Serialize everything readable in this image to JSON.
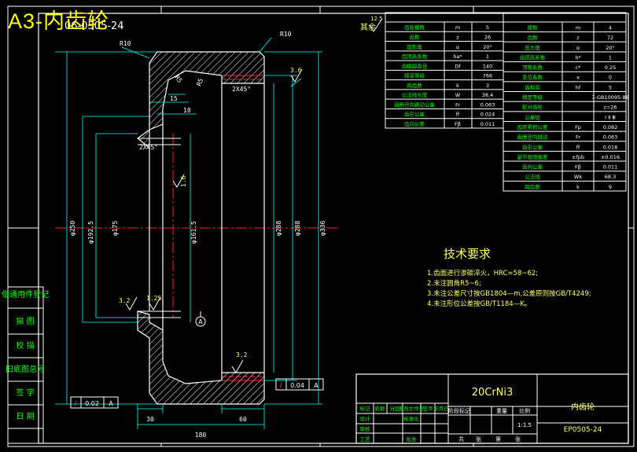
{
  "header": {
    "title": "A3-内齿轮",
    "underlay": "06-0505-24"
  },
  "drawing": {
    "material": "20CrNi3",
    "part_name": "内齿轮",
    "drawing_no": "EP0505-24",
    "scale": "1:1.5",
    "corner_note": "其余",
    "corner_roughness": "12.5"
  },
  "tech_requirements": {
    "title": "技术要求",
    "items": [
      "1.齿面进行渗碳淬火，HRC=58~62;",
      "2.未注圆角R5~6;",
      "3.未注公差尺寸按GB1804—m,公差原则按GB/T4249;",
      "4.未注形位公差按GB/T1184—K。"
    ]
  },
  "left_column": [
    "借通用件登记",
    "描 图",
    "校 描",
    "旧底图总号",
    "签 字",
    "日 期"
  ],
  "gear_table_left": [
    [
      "齿轮模数",
      "m",
      "5"
    ],
    [
      "齿数",
      "z",
      "26"
    ],
    [
      "齿形角",
      "α",
      "20°"
    ],
    [
      "齿顶高系数",
      "ha*",
      "1"
    ],
    [
      "齿根圆直径",
      "Df",
      "140"
    ],
    [
      "精度等级",
      "",
      "766"
    ],
    [
      "跨齿数",
      "k",
      "3"
    ],
    [
      "公法线长度",
      "W",
      "38.4"
    ],
    [
      "齿圈径向跳动公差",
      "Fr",
      "0.063"
    ],
    [
      "齿形公差",
      "ff",
      "0.024"
    ],
    [
      "齿向公差",
      "Fβ",
      "0.011"
    ]
  ],
  "gear_table_right": [
    [
      "模数",
      "m",
      "4"
    ],
    [
      "齿数",
      "z",
      "72"
    ],
    [
      "压力角",
      "α",
      "20°"
    ],
    [
      "齿顶高系数",
      "h*",
      "1"
    ],
    [
      "顶隙系数",
      "c*",
      "0.25"
    ],
    [
      "变位系数",
      "x",
      "0"
    ],
    [
      "齿根高",
      "hf",
      "5"
    ],
    [
      "精度等级",
      "",
      "7-GB10095-88"
    ],
    [
      "配对齿轮",
      "",
      "z=26"
    ],
    [
      "公差组",
      "",
      "Ⅰ Ⅱ Ⅲ"
    ],
    [
      "齿距累积公差",
      "Fp",
      "0.082"
    ],
    [
      "齿圈径向跳动",
      "Fr",
      "0.063"
    ],
    [
      "齿形公差",
      "ff",
      "0.018"
    ],
    [
      "基节极限偏差",
      "±fpb",
      "±0.016"
    ],
    [
      "齿向公差",
      "Fβ",
      "0.011"
    ],
    [
      "公法线",
      "Wk",
      "68.3"
    ],
    [
      "跨齿数",
      "k",
      "9"
    ]
  ],
  "title_block": {
    "rows": [
      [
        "标记",
        "处数",
        "分区",
        "更改文件号",
        "签字",
        "年月日"
      ],
      [
        "设计",
        "",
        "",
        "标准化",
        "",
        ""
      ],
      [
        "审核",
        "",
        "",
        "",
        "",
        ""
      ],
      [
        "工艺",
        "",
        "",
        "批准",
        "",
        ""
      ]
    ],
    "stage_headers": [
      "阶段标记",
      "重量",
      "比例"
    ],
    "sheet": [
      "共",
      "张",
      "第",
      "张"
    ]
  },
  "dimensions": {
    "d1": "φ250",
    "d2": "φ192.5",
    "d3": "φ175",
    "d4": "φ161.5",
    "d5": "φ288",
    "d6": "φ288",
    "d7": "φ336",
    "w1": "30",
    "w2": "180",
    "w3": "60",
    "w4": "15",
    "w5": "10",
    "r1": "R10",
    "r2": "R10",
    "r3": "R5",
    "r4": "R5",
    "rough1": "3.6",
    "rough2": "3.2",
    "rough3": "1.25",
    "rough4": "3.2",
    "rough5": "1.6",
    "tol1": "0.02",
    "tol2": "0.04",
    "datum": "A",
    "sec1": "2X45°",
    "sec2": "2X45°"
  }
}
